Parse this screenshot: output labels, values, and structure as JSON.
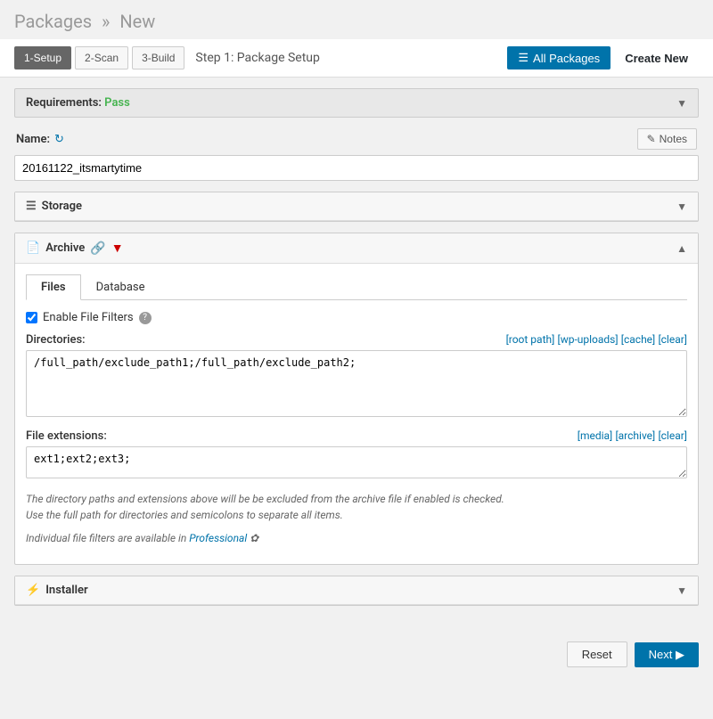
{
  "page": {
    "title": "Packages",
    "title_separator": "»",
    "title_new": "New"
  },
  "toolbar": {
    "step1_label": "1-Setup",
    "step2_label": "2-Scan",
    "step3_label": "3-Build",
    "step_description": "Step 1: Package Setup",
    "all_packages_label": "All Packages",
    "create_new_label": "Create New"
  },
  "requirements": {
    "label": "Requirements:",
    "status": "Pass"
  },
  "name_field": {
    "label": "Name:",
    "value": "20161122_itsmartytime",
    "notes_label": "Notes"
  },
  "storage": {
    "label": "Storage"
  },
  "archive": {
    "label": "Archive",
    "tabs": [
      "Files",
      "Database"
    ],
    "active_tab": "Files",
    "enable_filter_label": "Enable File Filters",
    "directories_label": "Directories:",
    "directories_links": [
      "[root path]",
      "[wp-uploads]",
      "[cache]",
      "[clear]"
    ],
    "directories_value": "/full_path/exclude_path1;/full_path/exclude_path2;",
    "file_ext_label": "File extensions:",
    "file_ext_links": [
      "[media]",
      "[archive]",
      "[clear]"
    ],
    "file_ext_value": "ext1;ext2;ext3;",
    "hint1": "The directory paths and extensions above will be be excluded from the archive file if enabled is checked.",
    "hint2": "Use the full path for directories and semicolons to separate all items.",
    "hint3": "Individual file filters are available in",
    "hint3_link": "Professional",
    "hint3_suffix": "✿"
  },
  "installer": {
    "label": "Installer"
  },
  "footer": {
    "reset_label": "Reset",
    "next_label": "Next ▶"
  }
}
